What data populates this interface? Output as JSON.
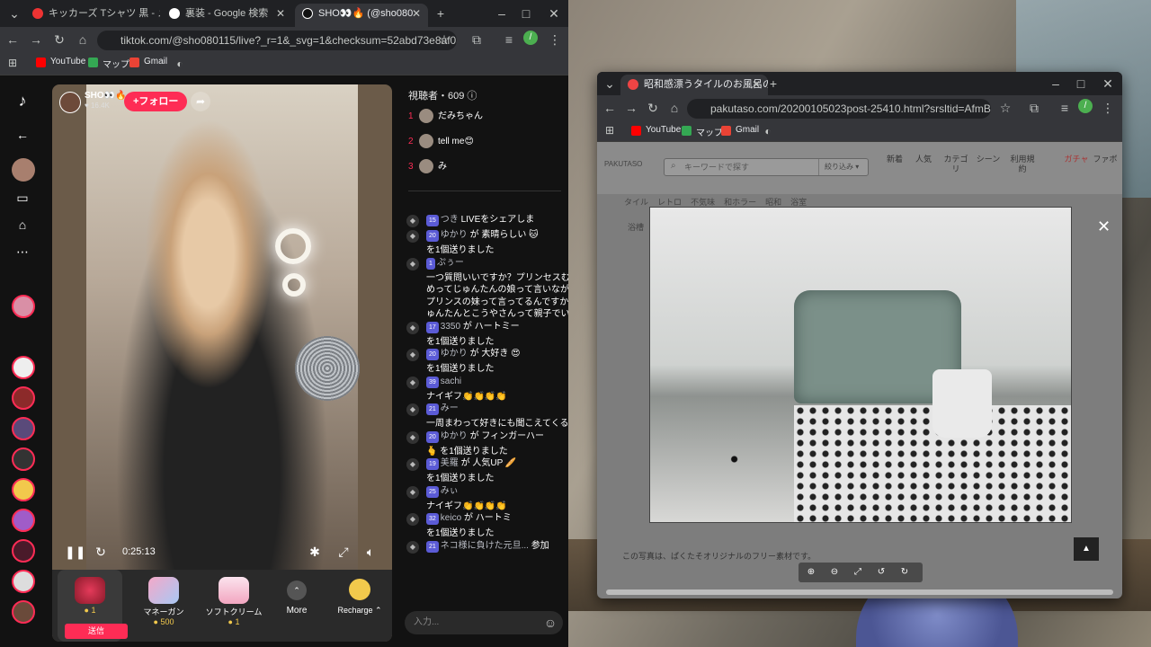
{
  "left_browser": {
    "tabs": [
      {
        "title": "キッカーズ Tシャツ 黒 - メルカリ"
      },
      {
        "title": "裏装 - Google 検索"
      },
      {
        "title": "SHO👀🔥 (@sho080"
      }
    ],
    "url": "tiktok.com/@sho080115/live?_r=1&_svg=1&checksum=52abd73e8af038f7f0...",
    "bookmarks": [
      "YouTube",
      "マップ",
      "Gmail"
    ]
  },
  "tiktok": {
    "host_name": "SHO👀🔥",
    "host_likes": "16.4K",
    "follow_label": "+フォロー",
    "timer": "0:25:13",
    "viewers_label": "視聴者・609",
    "top_viewers": [
      {
        "rank": "1",
        "name": "だみちゃん"
      },
      {
        "rank": "2",
        "name": "tell me😊"
      },
      {
        "rank": "3",
        "name": "み"
      }
    ],
    "chat": [
      {
        "level": "15",
        "name": "つき",
        "text": "LIVEをシェアしま"
      },
      {
        "level": "20",
        "name": "ゆかり",
        "text": "が 素晴らしい 🐱"
      },
      {
        "level": "",
        "name": "",
        "text": "を1個送りました"
      },
      {
        "level": "1",
        "name": "ぷぅー",
        "text": ""
      },
      {
        "level": "",
        "name": "",
        "text": "一つ質問いいですか？プリンセスむ"
      },
      {
        "level": "",
        "name": "",
        "text": "めってじゅんたんの娘って言いなが"
      },
      {
        "level": "",
        "name": "",
        "text": "プリンスの妹って言ってるんですか"
      },
      {
        "level": "",
        "name": "",
        "text": "ゅんたんとこうやさんって親子でい"
      },
      {
        "level": "17",
        "name": "3350",
        "text": "が ハートミー"
      },
      {
        "level": "",
        "name": "",
        "text": "を1個送りました"
      },
      {
        "level": "20",
        "name": "ゆかり",
        "text": "が 大好き 😍"
      },
      {
        "level": "",
        "name": "",
        "text": "を1個送りました"
      },
      {
        "level": "39",
        "name": "sachi",
        "text": ""
      },
      {
        "level": "",
        "name": "",
        "text": "ナイギフ👏👏👏👏"
      },
      {
        "level": "21",
        "name": "みー",
        "text": ""
      },
      {
        "level": "",
        "name": "",
        "text": "一周まわって好きにも聞こえてくる"
      },
      {
        "level": "20",
        "name": "ゆかり",
        "text": "が フィンガーハー"
      },
      {
        "level": "",
        "name": "",
        "text": "🫰 を1個送りました"
      },
      {
        "level": "19",
        "name": "美羅",
        "text": "が 人気UP 🥖"
      },
      {
        "level": "",
        "name": "",
        "text": "を1個送りました"
      },
      {
        "level": "25",
        "name": "みぃ",
        "text": ""
      },
      {
        "level": "",
        "name": "",
        "text": "ナイギフ👏👏👏👏"
      },
      {
        "level": "32",
        "name": "keico",
        "text": "が ハートミ"
      },
      {
        "level": "",
        "name": "",
        "text": "を1個送りました"
      },
      {
        "level": "21",
        "name": "ネコ様に負けた元旦...",
        "text": "参加"
      }
    ],
    "chat_placeholder": "入力...",
    "gifts": [
      {
        "name": "",
        "price": "1",
        "action": "送信"
      },
      {
        "name": "マネーガン",
        "price": "500"
      },
      {
        "name": "ソフトクリーム",
        "price": "1"
      },
      {
        "name": "More",
        "price": ""
      },
      {
        "name": "Recharge",
        "price": ""
      }
    ]
  },
  "right_browser": {
    "tab_title": "昭和感漂うタイルのお風呂の無料",
    "url": "pakutaso.com/20200105023post-25410.html?srsltid=AfmBOorWskucd_-u...",
    "bookmarks": [
      "YouTube",
      "マップ",
      "Gmail"
    ],
    "search_placeholder": "キーワードで探す",
    "filter_label": "絞り込み",
    "nav": [
      "新着",
      "人気",
      "カテゴリ",
      "シーン",
      "利用規約",
      "ガチャ",
      "ファボ"
    ],
    "tags": [
      "タイル",
      "レトロ",
      "不気味",
      "和ホラー",
      "昭和",
      "浴室",
      "浴槽"
    ],
    "caption": "この写真は、ぱくたそオリジナルのフリー素材です。"
  }
}
